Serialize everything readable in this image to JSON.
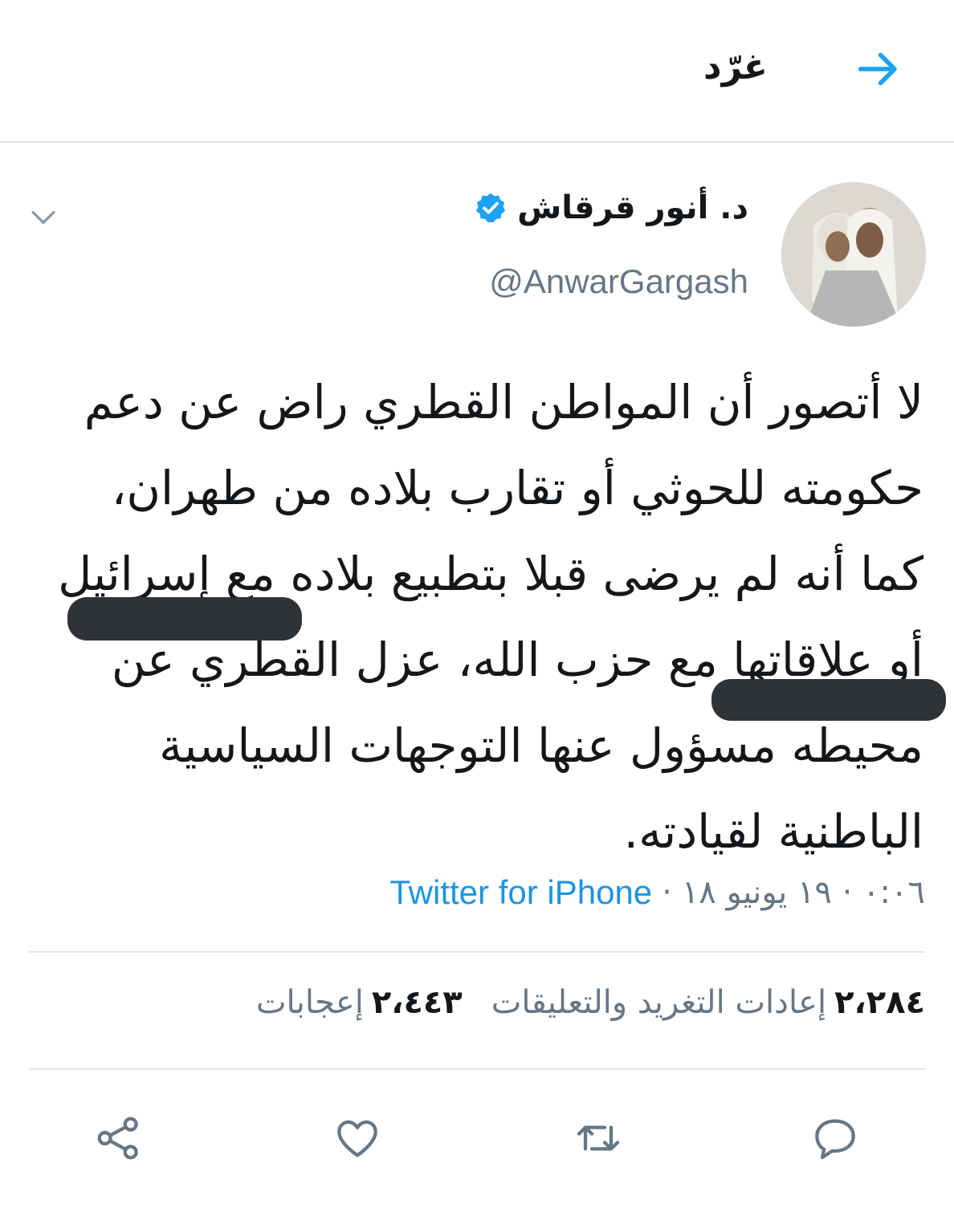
{
  "header": {
    "title": "غرّد",
    "back_icon": "arrow-right-icon"
  },
  "tweet": {
    "display_name": "د. أنور قرقاش",
    "handle": "@AnwarGargash",
    "verified": true,
    "text": "لا أتصور أن المواطن القطري راض عن دعم حكومته للحوثي أو تقارب بلاده من طهران، كما أنه لم يرضى قبلا بتطبيع بلاده مع إسرائيل أو علاقاتها مع حزب الله، عزل القطري عن محيطه مسؤول عنها التوجهات السياسية الباطنية لقيادته.",
    "timestamp": "٠:٠٦ · ١٩ يونيو ١٨",
    "source": "Twitter for iPhone"
  },
  "stats": {
    "retweets_count": "٢،٢٨٤",
    "retweets_label": "إعادات التغريد والتعليقات",
    "likes_count": "٢،٤٤٣",
    "likes_label": "إعجابات"
  },
  "colors": {
    "accent": "#1da1f2",
    "link": "#1b95e0",
    "muted": "#657786",
    "divider": "#e1e8ed",
    "text": "#14171a",
    "redaction": "#2f3236"
  },
  "icons": {
    "reply": "reply-icon",
    "retweet": "retweet-icon",
    "like": "heart-icon",
    "share": "share-icon",
    "menu": "chevron-down-icon",
    "verified": "verified-badge-icon"
  }
}
